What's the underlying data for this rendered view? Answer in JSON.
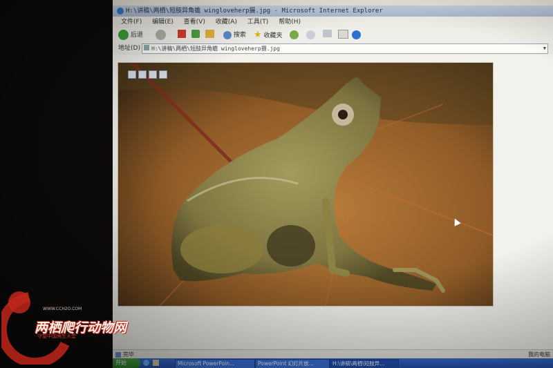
{
  "window": {
    "title": "H:\\讲稿\\两栖\\短肢异角蟾 wingloveherp摄.jpg - Microsoft Internet Explorer"
  },
  "menu": [
    "文件(F)",
    "编辑(E)",
    "查看(V)",
    "收藏(A)",
    "工具(T)",
    "帮助(H)"
  ],
  "toolbar": {
    "back_label": "后退",
    "search_label": "搜索",
    "favorites_label": "收藏夹"
  },
  "address": {
    "label": "地址(D)",
    "value": "H:\\讲稿\\两栖\\短肢异角蟾 wingloveherp摄.jpg"
  },
  "status": {
    "text": "完毕",
    "zone": "我的电脑"
  },
  "taskbar": {
    "start_label": "开始",
    "tasks": [
      "Microsoft PowerPoin...",
      "PowerPoint 幻灯片放...",
      "H:\\讲稿\\两栖\\短肢异..."
    ]
  },
  "watermark": {
    "text": "两栖爬行动物网",
    "subtitle": "守望中国两生天堂",
    "url": "WWW.CCH2O.COM"
  },
  "colors": {
    "titlebar": "#aab8cd",
    "taskbar": "#2453b6",
    "start": "#2f8a2f",
    "watermark": "#c0261b"
  }
}
